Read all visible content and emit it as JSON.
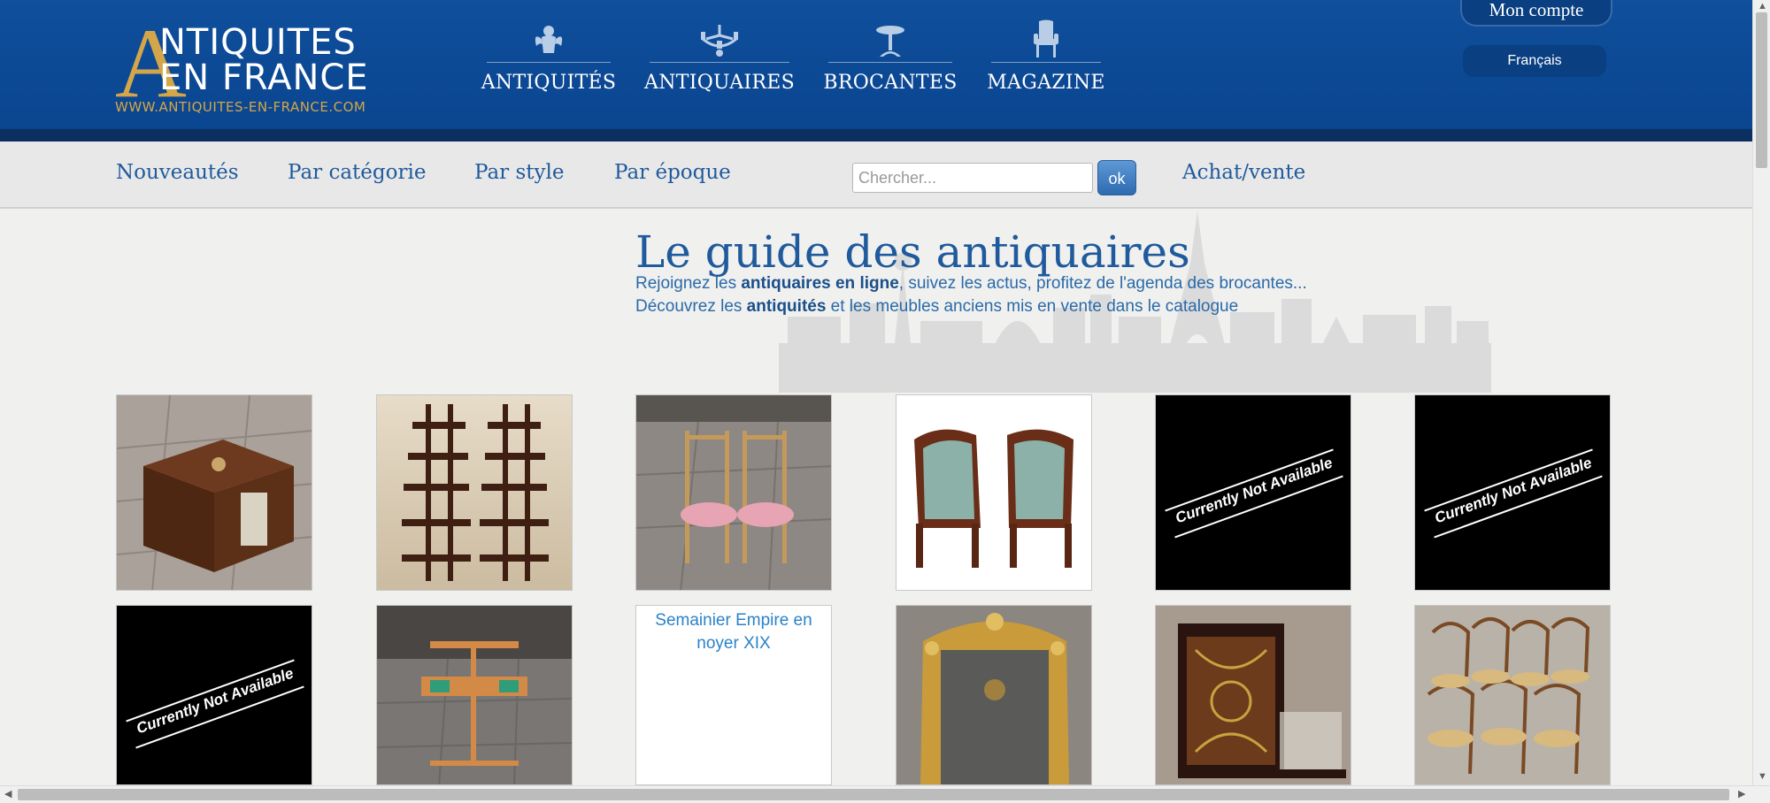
{
  "logo": {
    "big_letter": "A",
    "line1": "NTIQUITES",
    "line2": "EN FRANCE",
    "url": "WWW.ANTIQUITES-EN-FRANCE.COM"
  },
  "main_nav": [
    {
      "label": "ANTIQUITÉS",
      "icon": "cherub-icon"
    },
    {
      "label": "ANTIQUAIRES",
      "icon": "chandelier-icon"
    },
    {
      "label": "BROCANTES",
      "icon": "pedestal-table-icon"
    },
    {
      "label": "MAGAZINE",
      "icon": "armchair-icon"
    }
  ],
  "account": {
    "label": "Mon compte"
  },
  "language": {
    "label": "Français"
  },
  "sub_nav": {
    "items": [
      "Nouveautés",
      "Par catégorie",
      "Par style",
      "Par époque"
    ],
    "search_placeholder": "Chercher...",
    "search_button": "ok",
    "buy_sell": "Achat/vente"
  },
  "hero": {
    "title": "Le guide des antiquaires",
    "line1_pre": "Rejoignez les ",
    "line1_bold": "antiquaires en ligne",
    "line1_post": ", suivez les actus, profitez de l'agenda des brocantes...",
    "line2_pre": "Découvrez les ",
    "line2_bold": "antiquités",
    "line2_post": " et les meubles anciens mis en vente dans le catalogue"
  },
  "products": [
    {
      "kind": "revolving-bookcase-photo"
    },
    {
      "kind": "corner-shelves-photo"
    },
    {
      "kind": "pink-chairs-photo"
    },
    {
      "kind": "empire-armchairs-photo"
    },
    {
      "kind": "unavailable",
      "text": "Currently Not Available"
    },
    {
      "kind": "unavailable",
      "text": "Currently Not Available"
    },
    {
      "kind": "unavailable",
      "text": "Currently Not Available"
    },
    {
      "kind": "valet-stand-photo"
    },
    {
      "kind": "broken-image",
      "alt": "Semainier Empire en noyer XIX"
    },
    {
      "kind": "gilt-mirror-photo"
    },
    {
      "kind": "boulle-cabinet-photo"
    },
    {
      "kind": "bentwood-chairs-photo"
    }
  ],
  "colors": {
    "header_blue": "#0f4f9c",
    "gold": "#d4a64a",
    "link_blue": "#1f5a9c"
  }
}
